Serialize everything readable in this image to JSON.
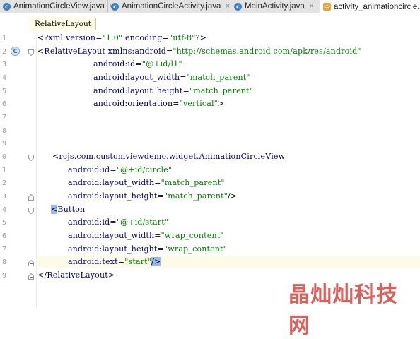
{
  "tabs": [
    {
      "label": "AnimationCircleView.java",
      "close": "×",
      "kind": "java"
    },
    {
      "label": "AnimationCircleActivity.java",
      "close": "×",
      "kind": "java"
    },
    {
      "label": "MainActivity.java",
      "close": "×",
      "kind": "java"
    },
    {
      "label": "activity_animationcircle.xml",
      "close": "",
      "kind": "xml"
    }
  ],
  "tooltip": "RelativeLayout",
  "gutter_badge": "C",
  "line_numbers": [
    "1",
    "2",
    "3",
    "4",
    "5",
    "6",
    "7",
    "8",
    "9",
    "0",
    "1",
    "2",
    "3",
    "4",
    "5",
    "6",
    "7",
    "8",
    "9"
  ],
  "code": {
    "l1": {
      "p1": "<?",
      "tag": "xml ",
      "a1": "version",
      "eq1": "=",
      "v1": "\"1.0\"",
      "a2": " encoding",
      "eq2": "=",
      "v2": "\"utf-8\"",
      "p2": "?>"
    },
    "l2": {
      "p1": "<",
      "tag": "RelativeLayout ",
      "attr": "xmlns:android",
      "eq": "=",
      "val": "\"http://schemas.android.com/apk/res/android\""
    },
    "l3": {
      "attr": "android:id",
      "eq": "=",
      "val": "\"@+id/l1\""
    },
    "l4": {
      "attr": "android:layout_width",
      "eq": "=",
      "val": "\"match_parent\""
    },
    "l5": {
      "attr": "android:layout_height",
      "eq": "=",
      "val": "\"match_parent\""
    },
    "l6": {
      "attr": "android:orientation",
      "eq": "=",
      "val": "\"vertical\"",
      "close": ">"
    },
    "l10": {
      "p1": "<",
      "tag": "rcjs.com.customviewdemo.widget.AnimationCircleView"
    },
    "l11": {
      "attr": "android:id",
      "eq": "=",
      "val": "\"@+id/circle\""
    },
    "l12": {
      "attr": "android:layout_width",
      "eq": "=",
      "val": "\"match_parent\""
    },
    "l13": {
      "attr": "android:layout_height",
      "eq": "=",
      "val": "\"match_parent\"",
      "close": "/>"
    },
    "l14": {
      "p1": "<",
      "tag": "Button"
    },
    "l15": {
      "attr": "android:id",
      "eq": "=",
      "val": "\"@+id/start\""
    },
    "l16": {
      "attr": "android:layout_width",
      "eq": "=",
      "val": "\"wrap_content\""
    },
    "l17": {
      "attr": "android:layout_height",
      "eq": "=",
      "val": "\"wrap_content\""
    },
    "l18": {
      "attr": "android:text",
      "eq": "=",
      "val": "\"start\"",
      "close": "/>"
    },
    "l19": {
      "p1": "</",
      "tag": "RelativeLayout",
      "p2": ">"
    }
  },
  "watermark": "晶灿灿科技网",
  "colors": {
    "tag": "#000080",
    "value": "#008000",
    "tab_bar": "#e3e3e3",
    "watermark": "#d9534f"
  }
}
